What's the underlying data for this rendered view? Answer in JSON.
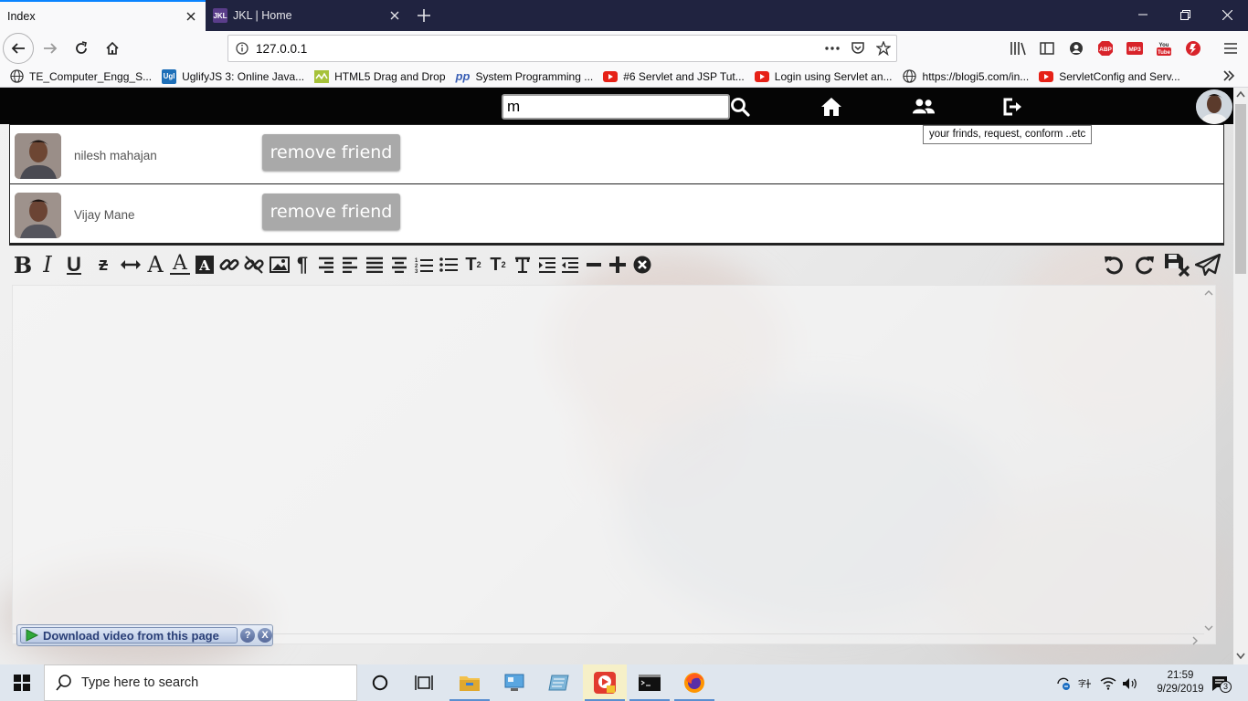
{
  "browser": {
    "tabs": [
      {
        "title": "Index",
        "active": true
      },
      {
        "title": "JKL | Home",
        "favicon_text": "JKL",
        "active": false
      }
    ],
    "url": "127.0.0.1",
    "bookmarks": [
      {
        "label": "TE_Computer_Engg_S...",
        "icon": "globe-icon"
      },
      {
        "label": "UglifyJS 3: Online Java...",
        "icon_text": "Ugl",
        "icon": "uglify-icon"
      },
      {
        "label": "HTML5 Drag and Drop",
        "icon": "html5-icon"
      },
      {
        "label": "System Programming ...",
        "icon_text": "pp",
        "icon": "pp-icon"
      },
      {
        "label": "#6 Servlet and JSP Tut...",
        "icon": "youtube-icon"
      },
      {
        "label": "Login using Servlet an...",
        "icon": "youtube-icon"
      },
      {
        "label": "https://blogi5.com/in...",
        "icon": "globe-icon"
      },
      {
        "label": "ServletConfig and Serv...",
        "icon": "youtube-icon"
      }
    ]
  },
  "header": {
    "search_value": "m",
    "tooltip": "your frinds, request, conform ..etc"
  },
  "friends": [
    {
      "name": "nilesh mahajan",
      "action": "remove friend"
    },
    {
      "name": "Vijay Mane",
      "action": "remove friend"
    }
  ],
  "editor": {
    "toolbar_left": [
      "bold",
      "italic",
      "underline",
      "strikethrough",
      "horizontal-rule",
      "font-color",
      "background-color",
      "text-highlight",
      "link",
      "unlink",
      "image",
      "paragraph",
      "align-right",
      "align-left",
      "justify",
      "align-center",
      "ordered-list",
      "unordered-list",
      "subscript",
      "superscript",
      "remove-format",
      "indent",
      "outdent",
      "decrease",
      "increase",
      "close"
    ],
    "toolbar_right": [
      "undo",
      "redo",
      "save-close",
      "send"
    ]
  },
  "download_bar": {
    "label": "Download video from this page",
    "help": "?",
    "close": "X"
  },
  "taskbar": {
    "search_placeholder": "Type here to search",
    "time": "21:59",
    "date": "9/29/2019",
    "notifications": "3"
  },
  "colors": {
    "tab_accent": "#0a84ff",
    "tabbar_bg": "#202340",
    "topbar_bg": "#050505",
    "button_gray": "#a9a9a9",
    "taskbar_bg": "#dfe6ee"
  }
}
